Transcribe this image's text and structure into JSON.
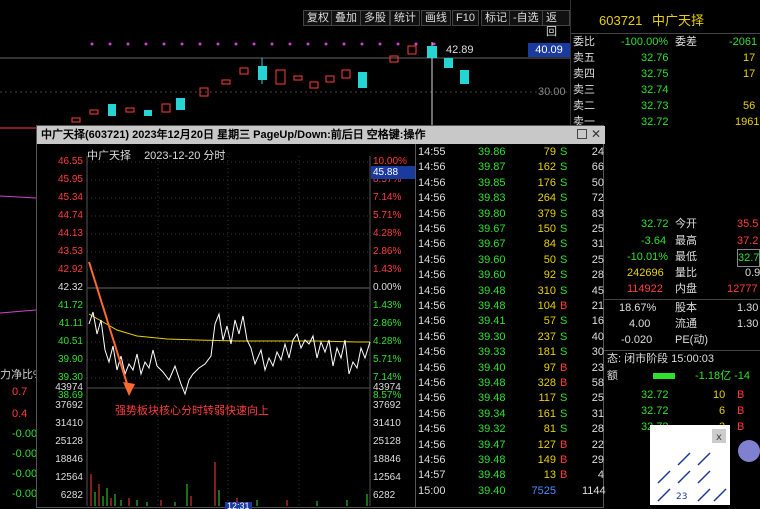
{
  "toolbar": {
    "buttons": [
      "复权",
      "叠加",
      "多股",
      "统计",
      "画线",
      "F10",
      "标记",
      "-自选",
      "返回"
    ]
  },
  "main_chart": {
    "price_high_label": "42.89",
    "current_price_badge": "40.09",
    "axis_label": "30.00"
  },
  "stock_header": {
    "code": "603721",
    "name": "中广天择"
  },
  "order_book": {
    "ratio_label": "委比",
    "ratio_value": "-100.00%",
    "diff_label": "委差",
    "diff_value": "-2061",
    "asks": [
      {
        "label": "卖五",
        "price": "32.76",
        "vol": "17"
      },
      {
        "label": "卖四",
        "price": "32.75",
        "vol": "17"
      },
      {
        "label": "卖三",
        "price": "32.74",
        "vol": ""
      },
      {
        "label": "卖二",
        "price": "32.73",
        "vol": "56"
      },
      {
        "label": "卖一",
        "price": "32.72",
        "vol": "1961"
      }
    ]
  },
  "quote": [
    {
      "v1": "32.72",
      "l2": "今开",
      "v2": "35.5"
    },
    {
      "v1": "-3.64",
      "l2": "最高",
      "v2": "37.2"
    },
    {
      "v1": "-10.01%",
      "l2": "最低",
      "v2": "32.7"
    },
    {
      "v1": "242696",
      "l2": "量比",
      "v2": "0.9"
    },
    {
      "v1": "114922",
      "l2": "内盘",
      "v2": "12777"
    },
    {
      "v1": "18.67%",
      "l2": "股本",
      "v2": "1.30"
    },
    {
      "v1": "4.00",
      "l2": "流通",
      "v2": "1.30"
    },
    {
      "v1": "-0.020",
      "l2": "PE(动)",
      "v2": ""
    }
  ],
  "stage_label": "态: 闭市阶段 15:00:03",
  "net_amount": {
    "label": "额",
    "value": "-1.18亿 -14"
  },
  "bottom_ticks": [
    {
      "p": "32.72",
      "v": "10",
      "f": "B"
    },
    {
      "p": "32.72",
      "v": "6",
      "f": "B"
    },
    {
      "p": "32.72",
      "v": "3",
      "f": "B"
    }
  ],
  "left_panel": {
    "label": "力净比%",
    "values": [
      "0.7",
      "0.4",
      "-0.00",
      "-0.00",
      "-0.00",
      "-0.00"
    ]
  },
  "popup": {
    "title": "中广天择(603721) 2023年12月20日 星期三 PageUp/Down:前后日 空格键:操作",
    "subtitle_name": "中广天择",
    "subtitle_date": "2023-12-20 分时",
    "price_badge": "45.88",
    "annotation": "强势板块核心分时转弱快速向上",
    "time_tick": "12:31",
    "price_labels": [
      "46.55",
      "45.95",
      "45.34",
      "44.74",
      "44.13",
      "43.53",
      "42.92",
      "42.32",
      "41.72",
      "41.11",
      "40.51",
      "39.90",
      "39.30",
      "38.69"
    ],
    "pct_labels": [
      "10.00%",
      "8.57%",
      "7.14%",
      "5.71%",
      "4.28%",
      "2.86%",
      "1.43%",
      "0.00%",
      "1.43%",
      "2.86%",
      "4.28%",
      "5.71%",
      "7.14%",
      "8.57%"
    ],
    "vol_labels": [
      "43974",
      "37692",
      "31410",
      "25128",
      "18846",
      "12564",
      "6282"
    ],
    "ticks": [
      {
        "t": "14:55",
        "p": "39.86",
        "v": "79",
        "f": "S",
        "n": "24"
      },
      {
        "t": "14:56",
        "p": "39.87",
        "v": "162",
        "f": "S",
        "n": "66"
      },
      {
        "t": "14:56",
        "p": "39.85",
        "v": "176",
        "f": "S",
        "n": "50"
      },
      {
        "t": "14:56",
        "p": "39.83",
        "v": "264",
        "f": "S",
        "n": "72"
      },
      {
        "t": "14:56",
        "p": "39.80",
        "v": "379",
        "f": "S",
        "n": "83"
      },
      {
        "t": "14:56",
        "p": "39.67",
        "v": "150",
        "f": "S",
        "n": "25"
      },
      {
        "t": "14:56",
        "p": "39.67",
        "v": "84",
        "f": "S",
        "n": "31"
      },
      {
        "t": "14:56",
        "p": "39.60",
        "v": "50",
        "f": "S",
        "n": "25"
      },
      {
        "t": "14:56",
        "p": "39.60",
        "v": "92",
        "f": "S",
        "n": "28"
      },
      {
        "t": "14:56",
        "p": "39.48",
        "v": "310",
        "f": "S",
        "n": "45"
      },
      {
        "t": "14:56",
        "p": "39.48",
        "v": "104",
        "f": "B",
        "n": "21"
      },
      {
        "t": "14:56",
        "p": "39.41",
        "v": "57",
        "f": "S",
        "n": "16"
      },
      {
        "t": "14:56",
        "p": "39.30",
        "v": "237",
        "f": "S",
        "n": "40"
      },
      {
        "t": "14:56",
        "p": "39.33",
        "v": "181",
        "f": "S",
        "n": "30"
      },
      {
        "t": "14:56",
        "p": "39.40",
        "v": "97",
        "f": "B",
        "n": "23"
      },
      {
        "t": "14:56",
        "p": "39.48",
        "v": "328",
        "f": "B",
        "n": "58"
      },
      {
        "t": "14:56",
        "p": "39.48",
        "v": "117",
        "f": "S",
        "n": "25"
      },
      {
        "t": "14:56",
        "p": "39.34",
        "v": "161",
        "f": "S",
        "n": "31"
      },
      {
        "t": "14:56",
        "p": "39.32",
        "v": "81",
        "f": "S",
        "n": "28"
      },
      {
        "t": "14:56",
        "p": "39.47",
        "v": "127",
        "f": "B",
        "n": "22"
      },
      {
        "t": "14:56",
        "p": "39.48",
        "v": "149",
        "f": "B",
        "n": "29"
      },
      {
        "t": "14:57",
        "p": "39.48",
        "v": "13",
        "f": "B",
        "n": "4"
      },
      {
        "t": "15:00",
        "p": "39.40",
        "v": "7525",
        "f": "",
        "n": "1144"
      }
    ]
  },
  "colors": {
    "up": "#ff3b3b",
    "down": "#2ee02e",
    "candle_down": "#26d4d4",
    "avg_line": "#e8d000"
  }
}
